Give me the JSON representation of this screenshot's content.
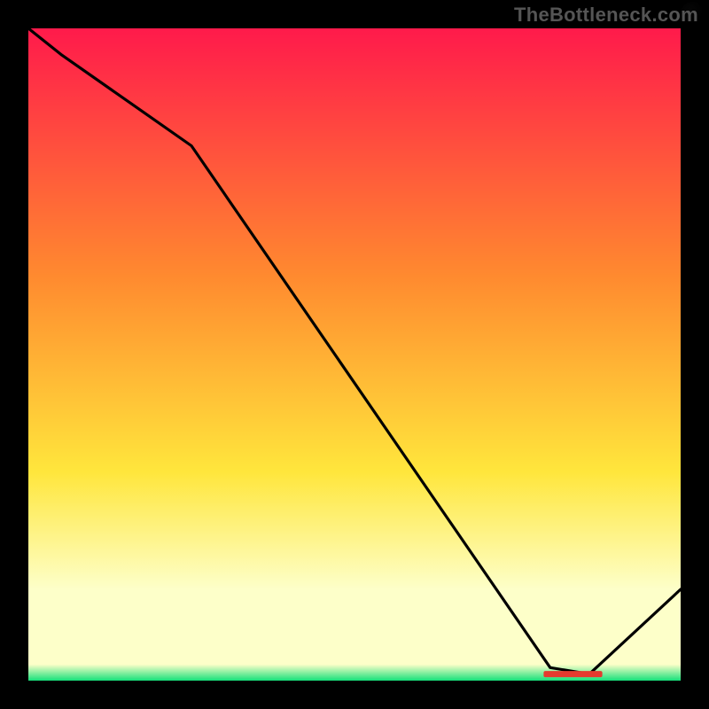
{
  "watermark": "TheBottleneck.com",
  "colors": {
    "top": "#ff1a4b",
    "mid1": "#ff8a2f",
    "mid2": "#ffe63c",
    "pale": "#fdffc9",
    "green": "#15e07a",
    "line": "#000000",
    "bg": "#000000",
    "marker_fill": "#e43b2f",
    "marker_text": "#5a2218"
  },
  "chart_data": {
    "type": "line",
    "title": "",
    "xlabel": "",
    "ylabel": "",
    "xlim": [
      0,
      100
    ],
    "ylim": [
      0,
      100
    ],
    "x": [
      0,
      5,
      25,
      80,
      86,
      100
    ],
    "values": [
      100,
      96,
      82,
      2,
      1,
      14
    ],
    "minimum_marker": {
      "x_range": [
        79,
        88
      ],
      "y": 1,
      "label": ""
    },
    "notes": "x and y are percentages of the plot area; curve falls from top-left, kinks near x≈25, reaches minimum near x≈83, then rises toward bottom-right."
  }
}
